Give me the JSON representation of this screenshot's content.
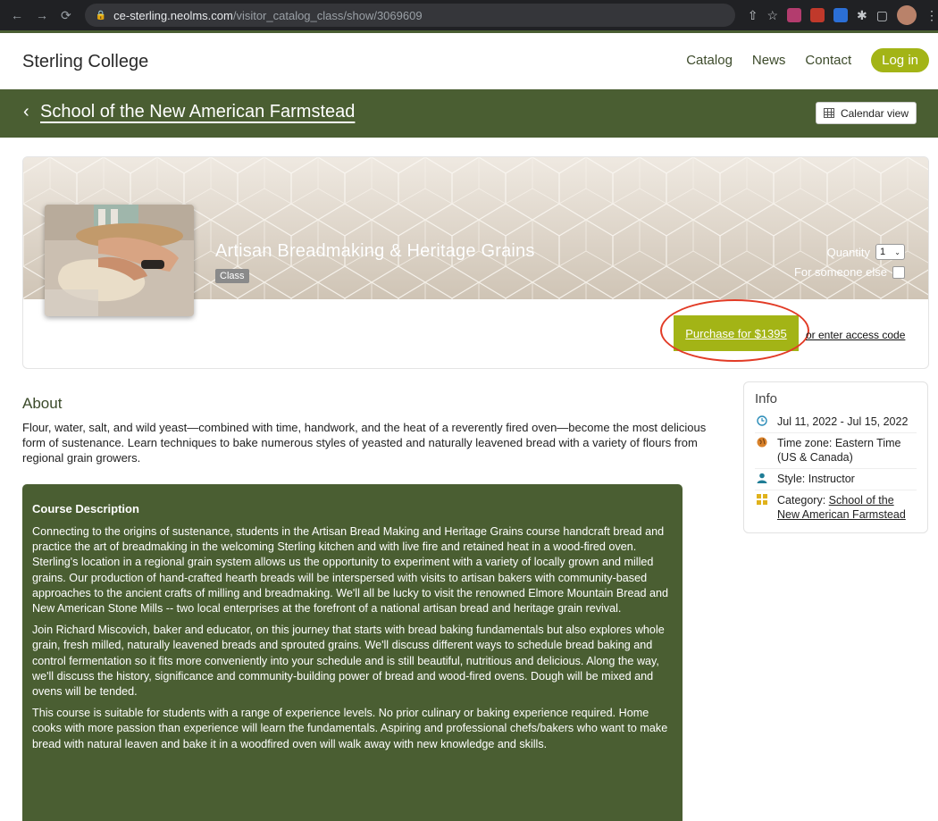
{
  "browser": {
    "url_host": "ce-sterling.neolms.com",
    "url_path": "/visitor_catalog_class/show/3069609"
  },
  "site": {
    "brand": "Sterling College",
    "nav": [
      "Catalog",
      "News",
      "Contact"
    ],
    "login": "Log in"
  },
  "band": {
    "title": "School of the New American Farmstead",
    "calendar_view": "Calendar view"
  },
  "course": {
    "title": "Artisan Breadmaking & Heritage Grains",
    "badge": "Class",
    "quantity_label": "Quantity",
    "quantity_value": "1",
    "someone_else_label": "For someone else",
    "purchase_label": "Purchase for $1395",
    "access_code_label": "or enter access code"
  },
  "about": {
    "heading": "About",
    "text": "Flour, water, salt, and wild yeast—combined with time, handwork, and the heat of a reverently fired oven—become the most delicious form of sustenance. Learn techniques to bake numerous styles of yeasted and naturally leavened bread with a variety of flours from regional grain growers."
  },
  "description": {
    "heading": "Course Description",
    "paragraphs": [
      "Connecting to the origins of sustenance, students in the Artisan Bread Making and Heritage Grains course handcraft bread and practice the art of breadmaking in the welcoming Sterling kitchen and with live fire and retained heat in a wood-fired oven. Sterling's location in a regional grain system allows us the opportunity to experiment with a variety of locally grown and milled grains.  Our production of hand-crafted hearth breads will be interspersed with visits to artisan bakers with community-based approaches to the ancient crafts of milling and breadmaking. We'll all be lucky to visit the renowned Elmore Mountain Bread and New American Stone Mills -- two local enterprises at the forefront of a national artisan bread and heritage grain revival.",
      "Join Richard Miscovich, baker and educator, on this journey that starts with bread baking fundamentals but also explores whole grain, fresh milled, naturally leavened breads and sprouted grains. We'll discuss different ways to schedule bread baking and control fermentation so it fits more conveniently into your schedule and is still beautiful, nutritious and delicious. Along the way, we'll discuss the history, significance and community-building power of bread and wood-fired ovens. Dough will be mixed and ovens will be tended.",
      "This course is suitable for students with a range of experience levels. No prior culinary or baking experience required. Home cooks with more passion than experience will learn the fundamentals. Aspiring and professional chefs/bakers who want to make bread with natural leaven and bake it in a woodfired oven will walk away with new knowledge and skills."
    ]
  },
  "info": {
    "heading": "Info",
    "dates": "Jul 11, 2022 - Jul 15, 2022",
    "timezone": "Time zone: Eastern Time (US & Canada)",
    "style": "Style: Instructor",
    "category_prefix": "Category: ",
    "category_link": "School of the New American Farmstead"
  },
  "colors": {
    "brand_green": "#4a5e32",
    "accent_lime": "#a3b416",
    "annotation_red": "#e23b26"
  }
}
